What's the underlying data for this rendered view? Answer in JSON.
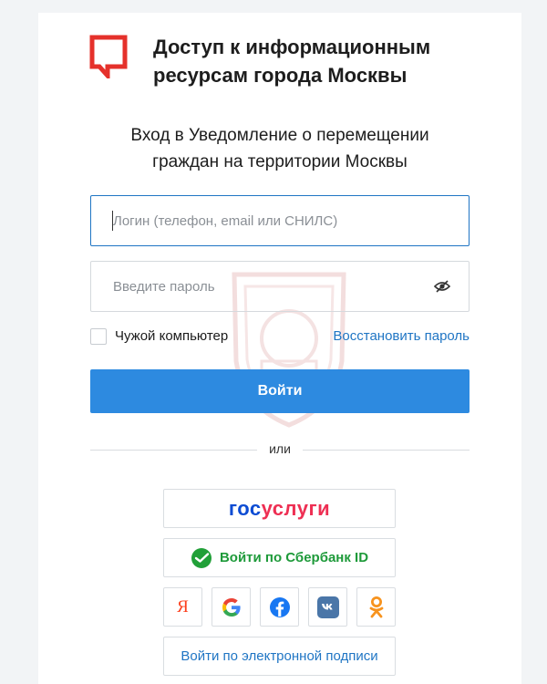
{
  "header": {
    "title_line1": "Доступ к информационным",
    "title_line2": "ресурсам города Москвы"
  },
  "subtitle": {
    "line1": "Вход в Уведомление о перемещении",
    "line2": "граждан на территории Москвы"
  },
  "form": {
    "login_placeholder": "Логин (телефон, email или СНИЛС)",
    "password_placeholder": "Введите пароль",
    "foreign_computer_label": "Чужой компьютер",
    "restore_password_link": "Восстановить пароль",
    "login_button": "Войти"
  },
  "divider": {
    "text": "или"
  },
  "alt_login": {
    "gosuslugi_part1": "гос",
    "gosuslugi_part2": "услуги",
    "sber_button": "Войти по Сбербанк ID",
    "yandex_glyph": "Я",
    "esign_button": "Войти по электронной подписи"
  },
  "colors": {
    "accent": "#2d8ae0",
    "link": "#1f75c4",
    "logo_red": "#e5312b",
    "sber_green": "#1e9a3a",
    "gos_blue": "#0d4cd3",
    "gos_red": "#ee2f53"
  },
  "icons": [
    "moscow-logo-icon",
    "eye-hidden-icon",
    "sber-icon",
    "yandex-icon",
    "google-icon",
    "facebook-icon",
    "vk-icon",
    "odnoklassniki-icon"
  ]
}
